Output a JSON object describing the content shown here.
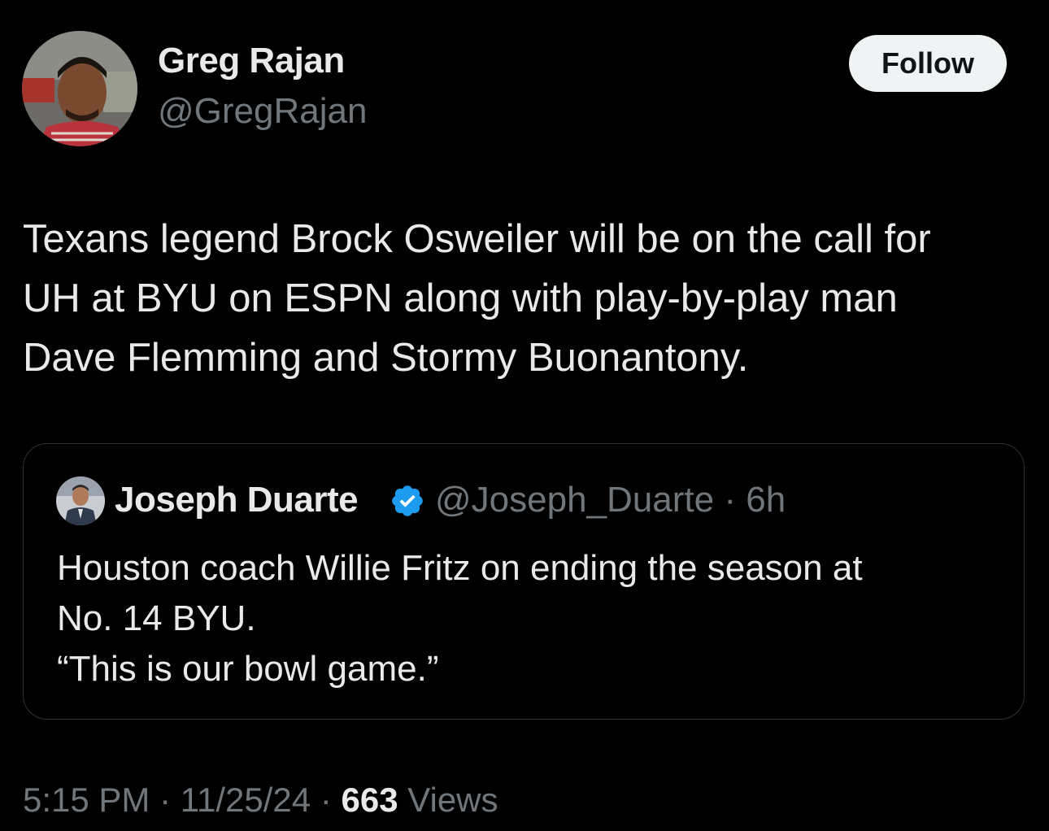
{
  "author": {
    "name": "Greg Rajan",
    "handle": "@GregRajan"
  },
  "follow_label": "Follow",
  "tweet": {
    "lines": [
      "Texans legend Brock Osweiler will be on the call for",
      "UH at BYU on ESPN along with play-by-play man",
      "Dave Flemming and Stormy Buonantony."
    ]
  },
  "quoted": {
    "name": "Joseph Duarte",
    "handle": "@Joseph_Duarte",
    "separator": "·",
    "time": "6h",
    "lines": [
      "Houston coach Willie Fritz on ending the season at",
      "No. 14 BYU.",
      "“This is our bowl game.”"
    ]
  },
  "footer": {
    "time": "5:15 PM",
    "separator": "·",
    "date": "11/25/24",
    "views_count": "663",
    "views_label": "Views"
  },
  "colors": {
    "background": "#000000",
    "text": "#e7e9ea",
    "secondary": "#71767b",
    "verified": "#1d9bf0",
    "border": "#2f3336"
  }
}
